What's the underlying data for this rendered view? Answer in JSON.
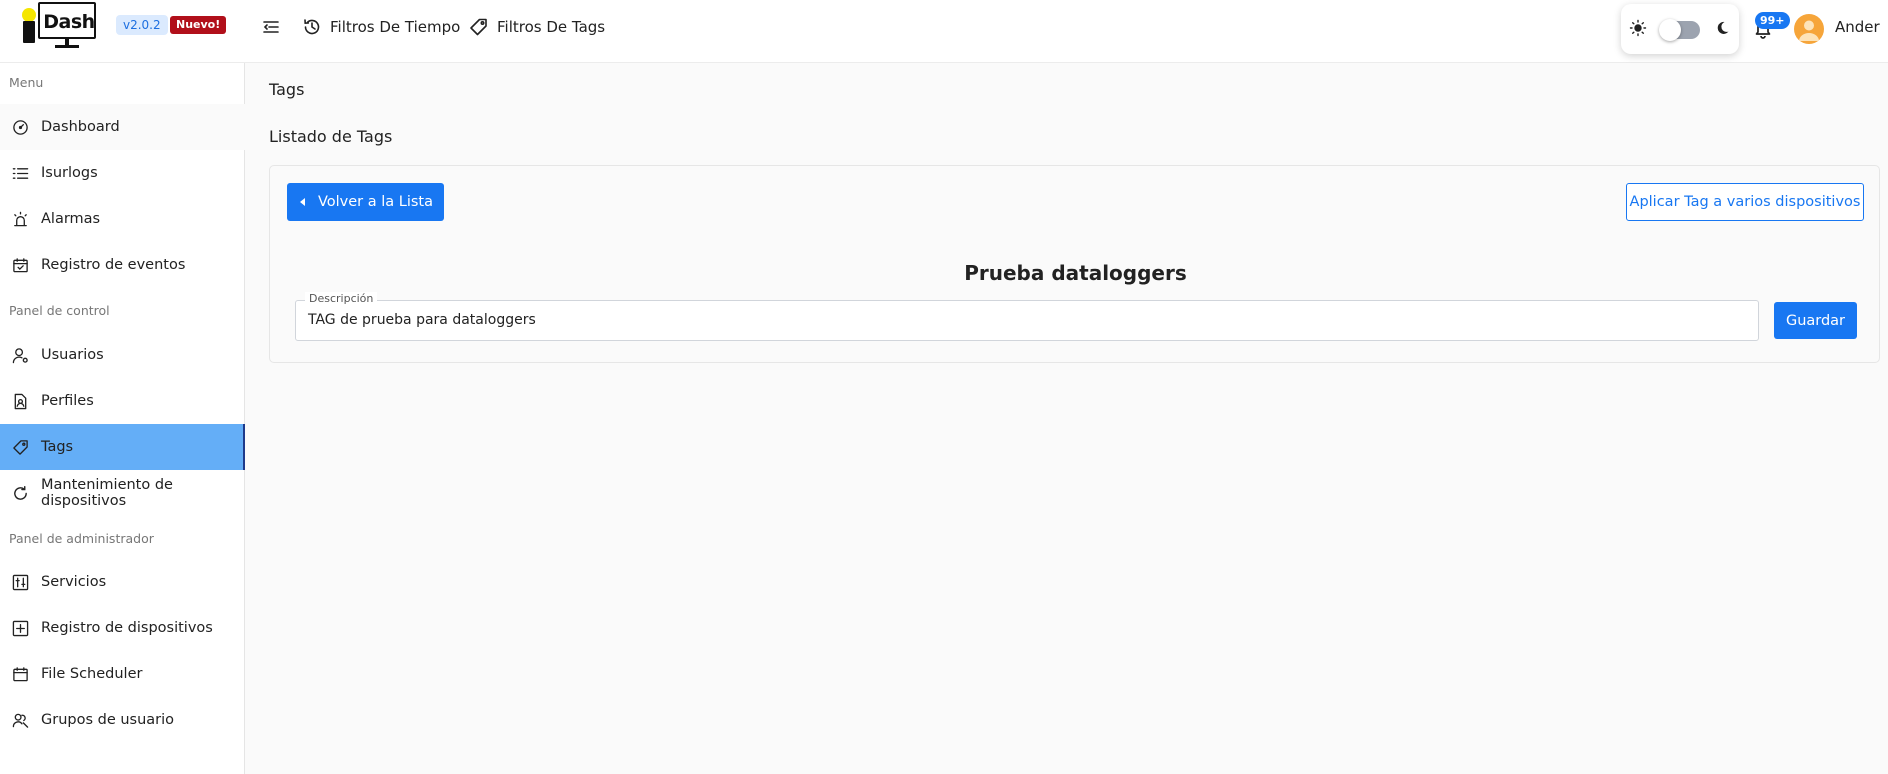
{
  "header": {
    "logo_text": "Dash",
    "version": "v2.0.2",
    "new_badge": "Nuevo!",
    "time_filters": "Filtros De Tiempo",
    "tag_filters": "Filtros De Tags",
    "notifications_count": "99+",
    "user_name": "Ander",
    "theme_mode": "light"
  },
  "sidebar": {
    "sections": [
      {
        "label": "Menu",
        "items": [
          {
            "label": "Dashboard",
            "icon": "gauge-icon"
          },
          {
            "label": "Isurlogs",
            "icon": "list-icon"
          },
          {
            "label": "Alarmas",
            "icon": "alarm-icon"
          },
          {
            "label": "Registro de eventos",
            "icon": "calendar-check-icon"
          }
        ]
      },
      {
        "label": "Panel de control",
        "items": [
          {
            "label": "Usuarios",
            "icon": "user-gear-icon"
          },
          {
            "label": "Perfiles",
            "icon": "profile-doc-icon"
          },
          {
            "label": "Tags",
            "icon": "tag-icon",
            "active": true
          },
          {
            "label": "Mantenimiento de dispositivos",
            "icon": "refresh-icon"
          }
        ]
      },
      {
        "label": "Panel de administrador",
        "items": [
          {
            "label": "Servicios",
            "icon": "sliders-icon"
          },
          {
            "label": "Registro de dispositivos",
            "icon": "plus-square-icon"
          },
          {
            "label": "File Scheduler",
            "icon": "calendar-icon"
          },
          {
            "label": "Grupos de usuario",
            "icon": "user-group-icon"
          }
        ]
      }
    ]
  },
  "main": {
    "page_title": "Tags",
    "section_title": "Listado de Tags",
    "back_button": "Volver a la Lista",
    "apply_button": "Aplicar Tag a varios dispositivos",
    "tag_name": "Prueba dataloggers",
    "description_label": "Descripción",
    "description_value": "TAG de prueba para dataloggers",
    "save_button": "Guardar"
  },
  "colors": {
    "primary": "#1877f2",
    "active_nav": "#64aef7",
    "new_badge": "#b10f1a",
    "version_badge_bg": "#dbeafe"
  }
}
